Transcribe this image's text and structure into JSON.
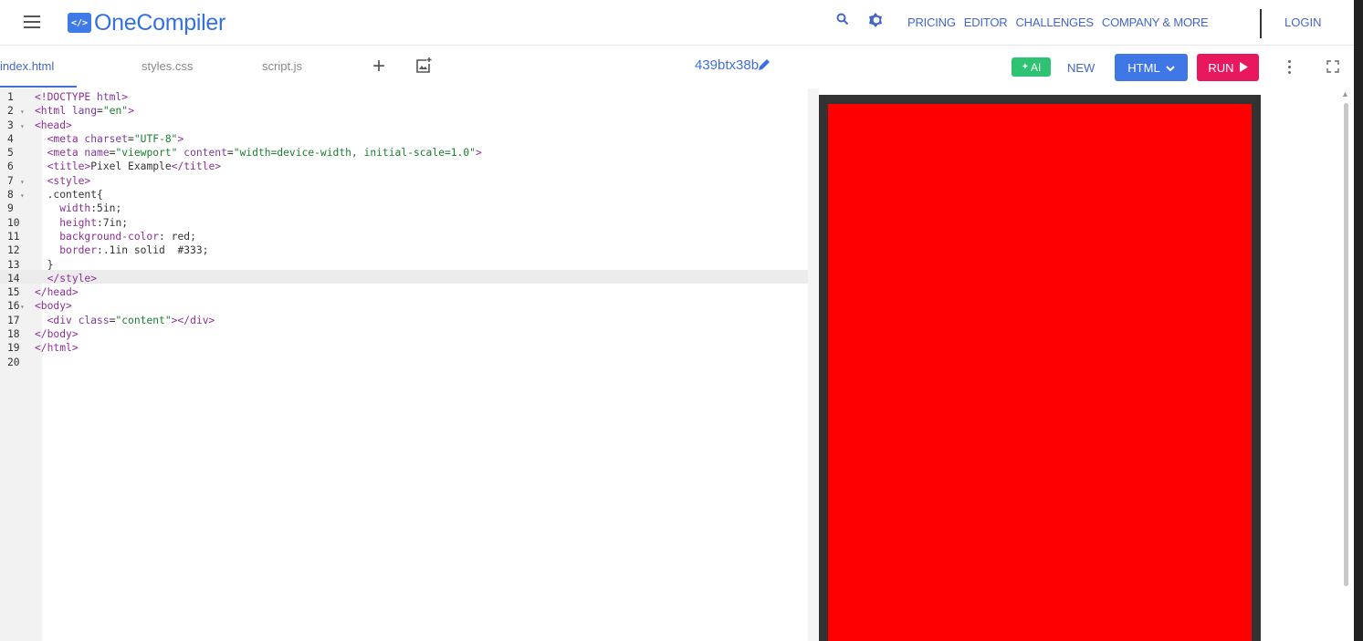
{
  "header": {
    "logo_glyph": "</>",
    "logo_text": "OneCompiler",
    "nav": [
      "PRICING",
      "EDITOR",
      "CHALLENGES",
      "COMPANY & MORE"
    ],
    "login": "LOGIN",
    "icons": [
      "menu-icon",
      "search-icon",
      "theme-toggle-icon"
    ]
  },
  "toolbar": {
    "tabs": [
      "index.html",
      "styles.css",
      "script.js"
    ],
    "active_tab": "index.html",
    "project_name": "439btx38b",
    "ai_label": "AI",
    "new_label": "NEW",
    "language_label": "HTML",
    "run_label": "RUN",
    "icons": [
      "add-file-icon",
      "upload-image-icon",
      "edit-pencil-icon",
      "more-vertical-icon",
      "fullscreen-icon"
    ]
  },
  "editor": {
    "language": "html",
    "active_line": 13,
    "lines": [
      {
        "n": "1",
        "fold": "",
        "code": "<!DOCTYPE html>"
      },
      {
        "n": "2",
        "fold": "▾",
        "code": "<html lang=\"en\">"
      },
      {
        "n": "3",
        "fold": "▾",
        "code": "<head>"
      },
      {
        "n": "4",
        "fold": "",
        "code": "  <meta charset=\"UTF-8\">"
      },
      {
        "n": "5",
        "fold": "",
        "code": "  <meta name=\"viewport\" content=\"width=device-width, initial-scale=1.0\">"
      },
      {
        "n": "6",
        "fold": "",
        "code": "  <title>Pixel Example</title>"
      },
      {
        "n": "7",
        "fold": "▾",
        "code": "  <style>"
      },
      {
        "n": "8",
        "fold": "▾",
        "code": "  .content{"
      },
      {
        "n": "9",
        "fold": "",
        "code": "    width:5in;"
      },
      {
        "n": "10",
        "fold": "",
        "code": "    height:7in;"
      },
      {
        "n": "11",
        "fold": "",
        "code": "    background-color: red;"
      },
      {
        "n": "12",
        "fold": "",
        "code": "    border:.1in solid  #333;"
      },
      {
        "n": "13",
        "fold": "",
        "code": "  }"
      },
      {
        "n": "14",
        "fold": "",
        "code": "  </style>"
      },
      {
        "n": "15",
        "fold": "",
        "code": "</head>"
      },
      {
        "n": "16",
        "fold": "▾",
        "code": "<body>"
      },
      {
        "n": "17",
        "fold": "",
        "code": "  <div class=\"content\"></div>"
      },
      {
        "n": "18",
        "fold": "",
        "code": "</body>"
      },
      {
        "n": "19",
        "fold": "",
        "code": "</html>"
      },
      {
        "n": "20",
        "fold": "",
        "code": ""
      }
    ]
  },
  "output": {
    "preview_background": "#ff0000",
    "preview_border_color": "#333333"
  },
  "colors": {
    "brand": "#3371e3",
    "run_button": "#e8185e",
    "html_button": "#3f78e6",
    "ai_button": "#2ec273"
  }
}
